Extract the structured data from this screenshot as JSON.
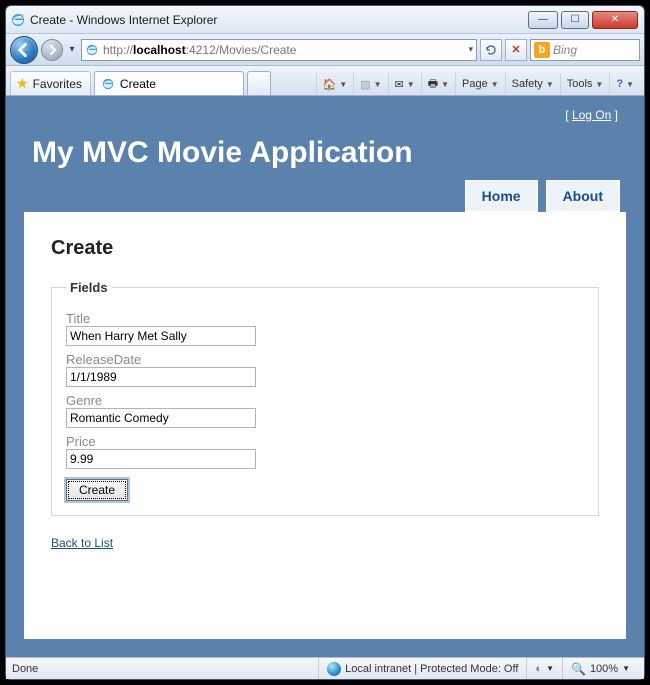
{
  "window_title": "Create - Windows Internet Explorer",
  "nav": {
    "url_prefix": "http://",
    "url_host": "localhost",
    "url_rest": ":4212/Movies/Create",
    "search_placeholder": "Bing"
  },
  "fav_label": "Favorites",
  "tab": {
    "title": "Create"
  },
  "cmd": {
    "page": "Page",
    "safety": "Safety",
    "tools": "Tools"
  },
  "header": {
    "logon": "Log On",
    "title": "My MVC Movie Application",
    "home": "Home",
    "about": "About"
  },
  "content": {
    "heading": "Create",
    "legend": "Fields",
    "labels": {
      "title": "Title",
      "releasedate": "ReleaseDate",
      "genre": "Genre",
      "price": "Price"
    },
    "values": {
      "title": "When Harry Met Sally",
      "releasedate": "1/1/1989",
      "genre": "Romantic Comedy",
      "price": "9.99"
    },
    "submit": "Create",
    "backlink": "Back to List"
  },
  "status": {
    "left": "Done",
    "zone": "Local intranet | Protected Mode: Off",
    "zoom": "100%"
  }
}
